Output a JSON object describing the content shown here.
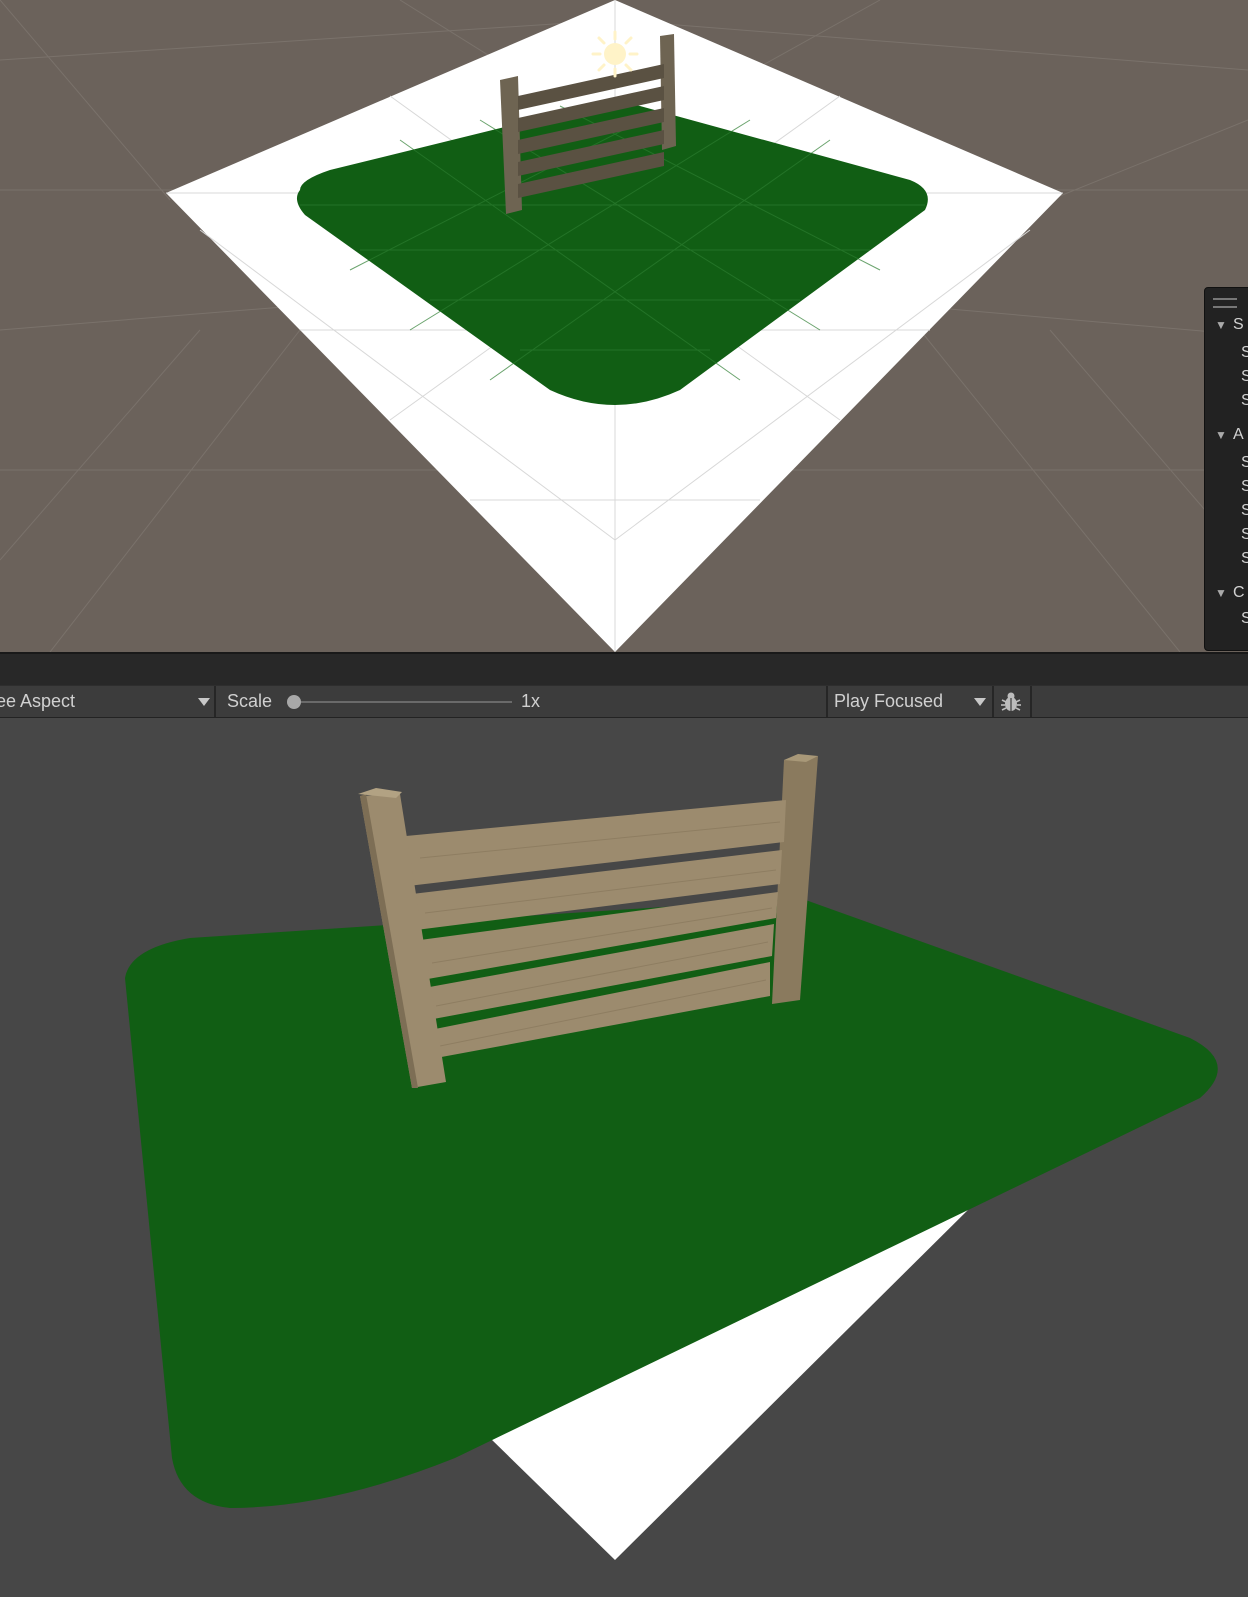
{
  "scene_view": {
    "overlay_panel": {
      "rows": [
        {
          "text": "S",
          "kind": "header"
        },
        {
          "text": "S",
          "kind": "child"
        },
        {
          "text": "S",
          "kind": "child"
        },
        {
          "text": "S",
          "kind": "child"
        },
        {
          "text": "A",
          "kind": "header"
        },
        {
          "text": "S",
          "kind": "child"
        },
        {
          "text": "S",
          "kind": "child"
        },
        {
          "text": "S",
          "kind": "child"
        },
        {
          "text": "S",
          "kind": "child"
        },
        {
          "text": "S",
          "kind": "child"
        },
        {
          "text": "C",
          "kind": "header"
        },
        {
          "text": "S",
          "kind": "child"
        }
      ]
    },
    "light_icon": "sun-icon"
  },
  "game_toolbar": {
    "aspect_label": "ee Aspect",
    "scale_label": "Scale",
    "scale_value": "1x",
    "scale_fraction": 0.0,
    "play_mode_label": "Play Focused",
    "bug_icon": "bug-icon"
  },
  "colors": {
    "scene_bg": "#6b625b",
    "game_bg": "#474747",
    "grass": "#115e14",
    "plane": "#ffffff",
    "wood": "#9c8b6e"
  }
}
